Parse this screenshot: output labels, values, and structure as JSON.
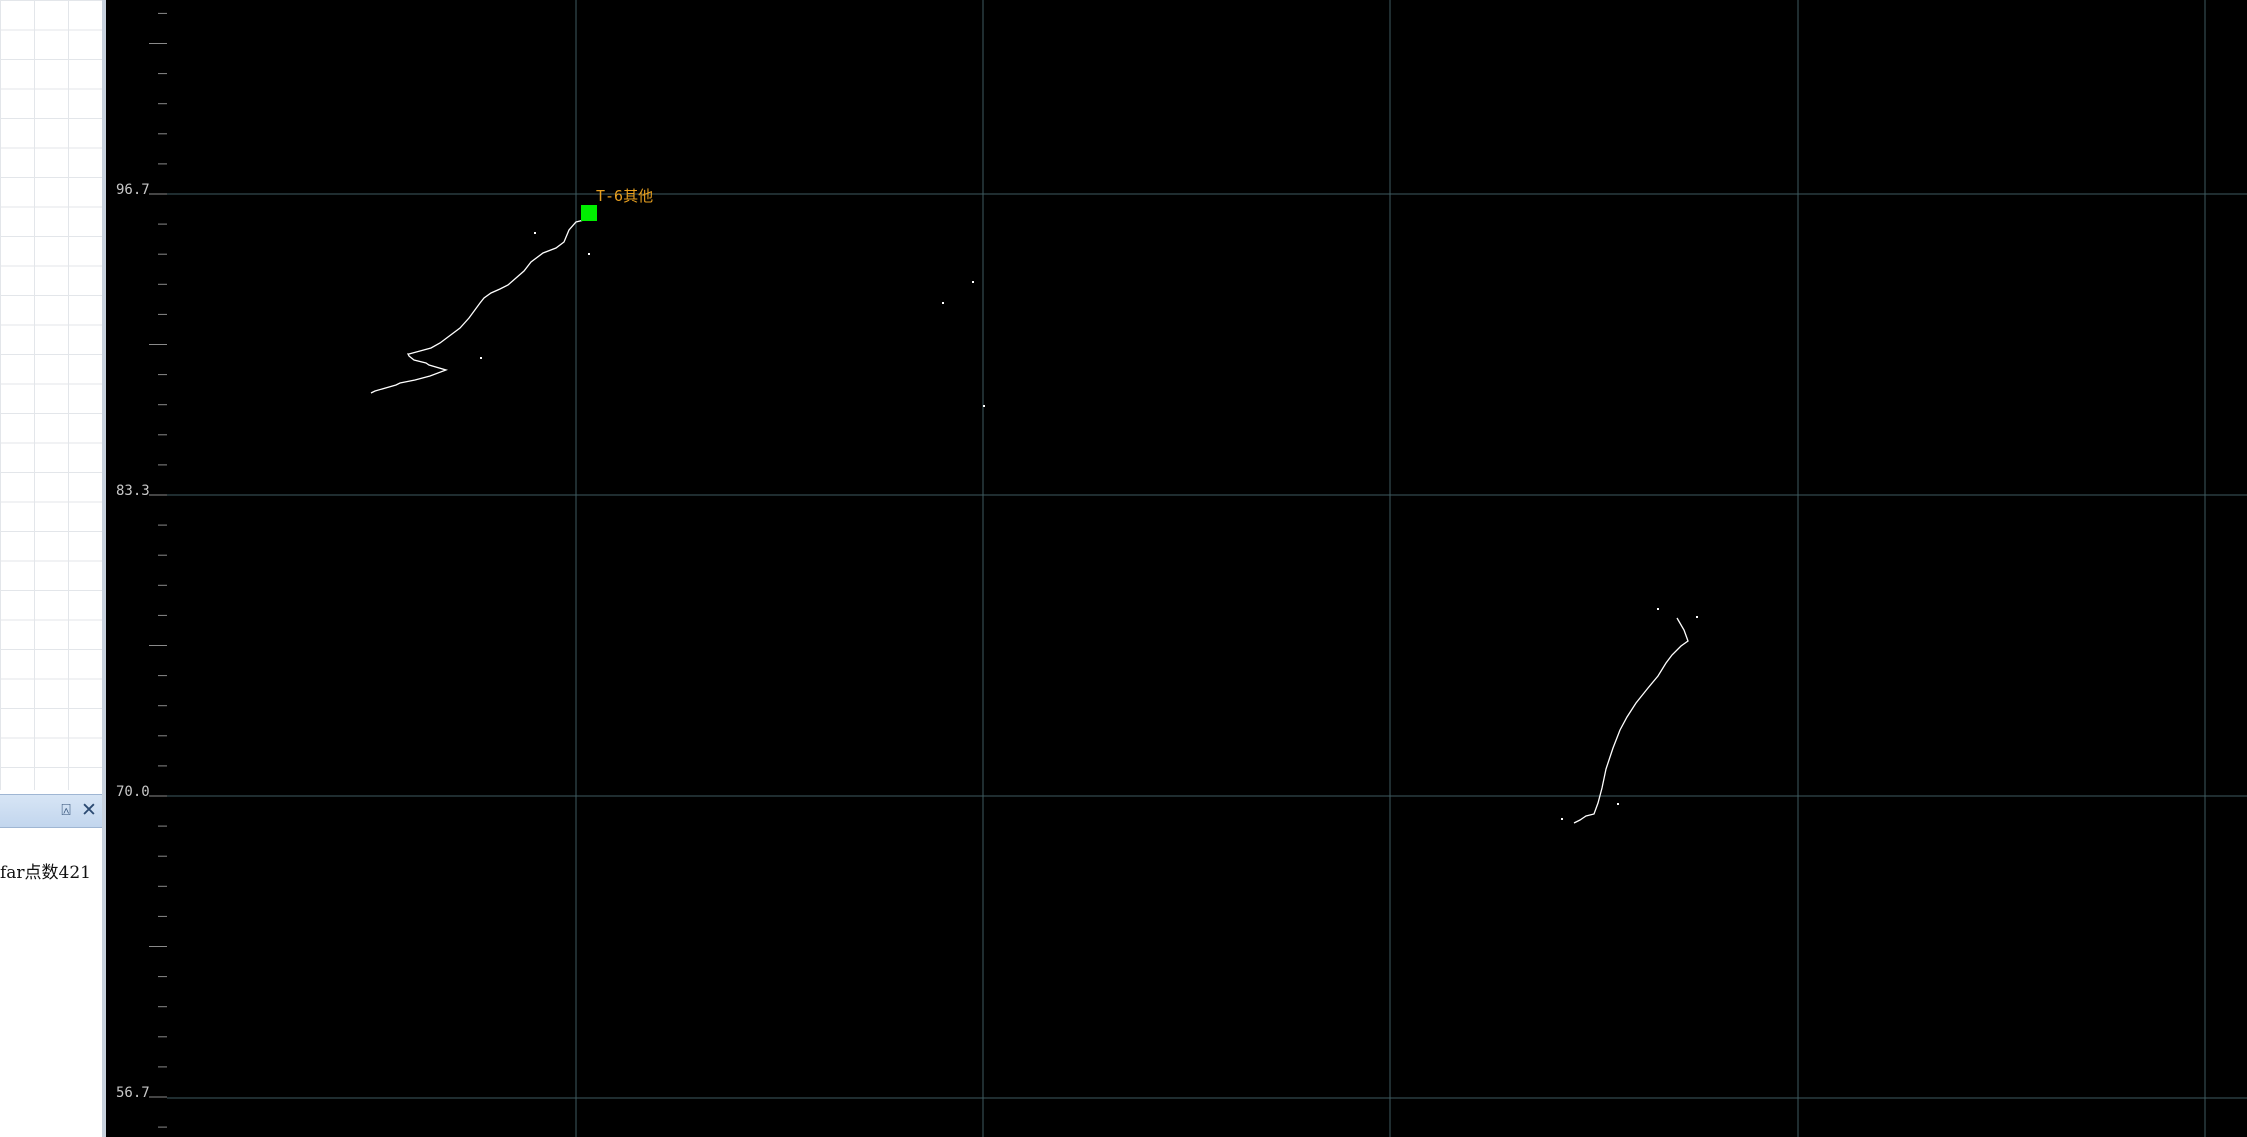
{
  "left_panel": {
    "output_panel": {
      "pin_icon": "pin-icon",
      "close_icon": "close-icon",
      "pin_glyph": "⍓",
      "close_glyph": "✕",
      "message": "far点数421"
    }
  },
  "plot": {
    "background": "#000000",
    "grid_color": "#3e5a60",
    "trace_color": "#ffffff",
    "marker_color": "#00ee00",
    "label_color": "#e8a020",
    "y_labels": [
      "96.7",
      "83.3",
      "70.0",
      "56.7"
    ],
    "marker_label": "T-6其他"
  }
}
